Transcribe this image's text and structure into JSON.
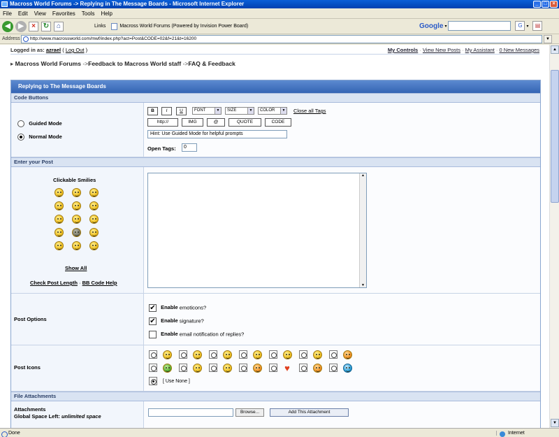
{
  "window": {
    "title": "Macross World Forums -> Replying in The Message Boards - Microsoft Internet Explorer"
  },
  "menu": [
    "File",
    "Edit",
    "View",
    "Favorites",
    "Tools",
    "Help"
  ],
  "toolbar": {
    "links_label": "Links",
    "link_page": "Macross World Forums (Powered by Invision Power Board)",
    "google_label": "Google",
    "google_dropdown": "▾"
  },
  "address": {
    "label": "Address",
    "url": "http://www.macrossworld.com/mwf/index.php?act=Post&CODE=02&f=21&t=16200"
  },
  "userbar": {
    "logged_label": "Logged in as:",
    "username": "azrael",
    "logout": "Log Out",
    "my_controls": "My Controls",
    "view_new_posts": "View New Posts",
    "my_assistant": "My Assistant",
    "new_messages": "0 New Messages",
    "sep": "·"
  },
  "breadcrumb": {
    "arrow": "▸",
    "sep": "->",
    "items": [
      "Macross World Forums",
      "Feedback to Macross World staff",
      "FAQ & Feedback"
    ]
  },
  "form": {
    "title": "Replying to The Message Boards",
    "code_buttons": {
      "section": "Code Buttons",
      "guided_mode": "Guided Mode",
      "normal_mode": "Normal Mode",
      "bold": "B",
      "italic": "I",
      "underline": "U",
      "font": "FONT",
      "size": "SIZE",
      "color": "COLOR",
      "close_all": "Close all Tags",
      "http": "http://",
      "img": "IMG",
      "email": "@",
      "quote": "QUOTE",
      "code": "CODE",
      "hint": "Hint: Use Guided Mode for helpful prompts",
      "open_tags_label": "Open Tags:",
      "open_tags_value": "0"
    },
    "post": {
      "section": "Enter your Post",
      "smilies_title": "Clickable Smilies",
      "show_all": "Show All",
      "check_length": "Check Post Length",
      "bb_help": "BB Code Help",
      "sep": "·"
    },
    "options": {
      "label": "Post Options",
      "enable_word": "Enable",
      "emoticons": "emoticons?",
      "signature": "signature?",
      "email_notify": "email notification of replies?"
    },
    "icons": {
      "label": "Post Icons",
      "use_none": "[ Use None ]"
    },
    "attachments": {
      "section": "File Attachments",
      "label": "Attachments",
      "global_space_label": "Global Space Left:",
      "global_space_value": "unlimited space",
      "browse": "Browse...",
      "add": "Add This Attachment"
    }
  },
  "status": {
    "left": "Done",
    "zone": "Internet"
  }
}
